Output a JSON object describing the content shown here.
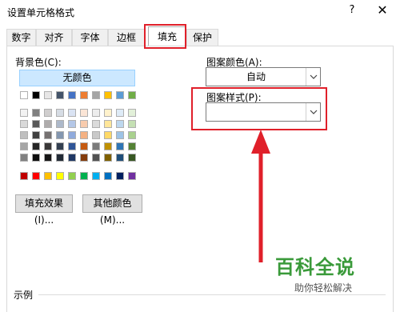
{
  "dialog": {
    "title": "设置单元格格式",
    "help_label": "?",
    "close_label": "✕"
  },
  "tabs": [
    {
      "label": "数字"
    },
    {
      "label": "对齐"
    },
    {
      "label": "字体"
    },
    {
      "label": "边框"
    },
    {
      "label": "填充"
    },
    {
      "label": "保护"
    }
  ],
  "fill": {
    "background_color_label": "背景色(C):",
    "no_color_label": "无颜色",
    "fill_effects_label": "填充效果(I)...",
    "more_colors_label": "其他颜色(M)...",
    "pattern_color_label": "图案颜色(A):",
    "pattern_color_value": "自动",
    "pattern_style_label": "图案样式(P):",
    "pattern_style_value": "",
    "sample_label": "示例"
  },
  "colors": {
    "row1": [
      "#ffffff",
      "#000000",
      "#e7e6e6",
      "#44546a",
      "#4472c4",
      "#ed7d31",
      "#a5a5a5",
      "#ffc000",
      "#5b9bd5",
      "#70ad47"
    ],
    "shade_rows": [
      [
        "#f2f2f2",
        "#808080",
        "#d0cece",
        "#d6dce4",
        "#dae3f3",
        "#fbe5d6",
        "#ededed",
        "#fff2cc",
        "#deebf7",
        "#e2f0d9"
      ],
      [
        "#d9d9d9",
        "#595959",
        "#aeabab",
        "#adb9ca",
        "#b4c7e7",
        "#f8cbad",
        "#dbdbdb",
        "#ffe699",
        "#bdd7ee",
        "#c5e0b4"
      ],
      [
        "#bfbfbf",
        "#404040",
        "#757171",
        "#8497b0",
        "#8faadc",
        "#f4b183",
        "#c9c9c9",
        "#ffd966",
        "#9dc3e6",
        "#a9d18e"
      ],
      [
        "#a6a6a6",
        "#262626",
        "#3a3838",
        "#333f50",
        "#2f5597",
        "#c55a11",
        "#7b7b7b",
        "#bf9000",
        "#2e75b6",
        "#548235"
      ],
      [
        "#808080",
        "#0d0d0d",
        "#171616",
        "#222a35",
        "#203864",
        "#843c0c",
        "#525252",
        "#7f6000",
        "#1f4e79",
        "#385723"
      ]
    ],
    "standard": [
      "#c00000",
      "#ff0000",
      "#ffc000",
      "#ffff00",
      "#92d050",
      "#00b050",
      "#00b0f0",
      "#0070c0",
      "#002060",
      "#7030a0"
    ]
  },
  "watermark": {
    "main": "百科全说",
    "sub": "助你轻松解决"
  }
}
